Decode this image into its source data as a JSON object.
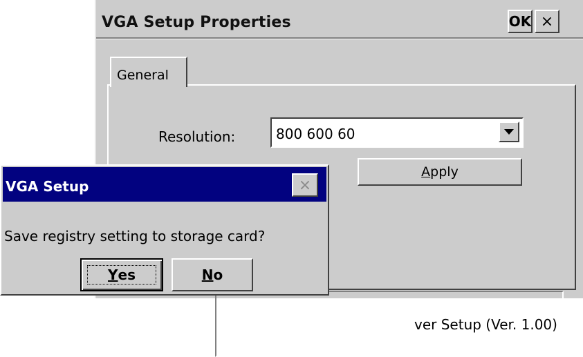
{
  "main_window": {
    "title": "VGA Setup Properties",
    "ok_label": "OK",
    "close_glyph": "×",
    "tabs": [
      {
        "label": "General",
        "active": true
      }
    ],
    "resolution": {
      "label": "Resolution:",
      "value": "800 600 60",
      "dropdown_icon": "chevron-down-icon"
    },
    "apply": {
      "label_prefix": "",
      "label_mnemonic": "A",
      "label_rest": "pply"
    },
    "info_text": "ver Setup (Ver. 1.00)"
  },
  "dialog": {
    "title": "VGA Setup",
    "close_glyph": "×",
    "message": "Save registry setting to storage card?",
    "yes": {
      "mnemonic": "Y",
      "rest": "es"
    },
    "no": {
      "mnemonic": "N",
      "rest": "o"
    }
  },
  "colors": {
    "face": "#cccccc",
    "dialog_title_bg": "#020280",
    "dialog_title_fg": "#ffffff"
  }
}
